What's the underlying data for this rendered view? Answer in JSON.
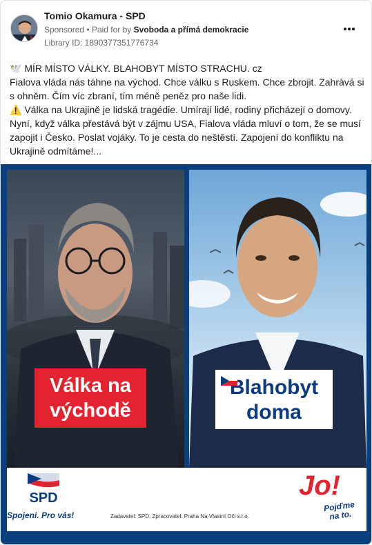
{
  "header": {
    "page_name": "Tomio Okamura - SPD",
    "sponsored": "Sponsored",
    "separator": "•",
    "paid_for_by": "Paid for by",
    "payer": "Svoboda a přímá demokracie",
    "library_id": "Library ID: 1890377351776734",
    "more_icon": "more-horizontal-icon"
  },
  "post": {
    "lines": [
      "🕊️ MÍR MÍSTO VÁLKY. BLAHOBYT MÍSTO STRACHU. cz",
      "Fialova vláda nás táhne na východ. Chce válku s Ruskem. Chce zbrojit. Zahrává si",
      "s ohněm. Čím víc zbraní, tím méně peněz pro naše lidi.",
      "⚠️ Válka na Ukrajině je lidská tragédie. Umírají lidé, rodiny přicházejí o domovy.",
      "Nyní, když válka přestává být v zájmu USA, Fialova vláda mluví o tom, že se musí",
      "zapojit i Česko. Poslat vojáky. To je cesta do neštěstí. Zapojení do konfliktu na",
      "Ukrajině odmítáme!..."
    ]
  },
  "creative": {
    "left_label_line1": "Válka na",
    "left_label_line2": "východě",
    "right_label_line1": "Blahobyt",
    "right_label_line2": "doma",
    "spd_logo_text": "SPD",
    "spd_slogan": "Spojeni. Pro vás!",
    "imprint": "Zadavatel: SPD. Zpracovatel: Praha Na Vlastní Oči s.r.o.",
    "jo_text": "Jo!",
    "jo_tag_line1": "Pojďme",
    "jo_tag_line2": "na to.",
    "colors": {
      "frame": "#0a3f7d",
      "red": "#e3232f",
      "navy": "#0c3b80"
    }
  }
}
